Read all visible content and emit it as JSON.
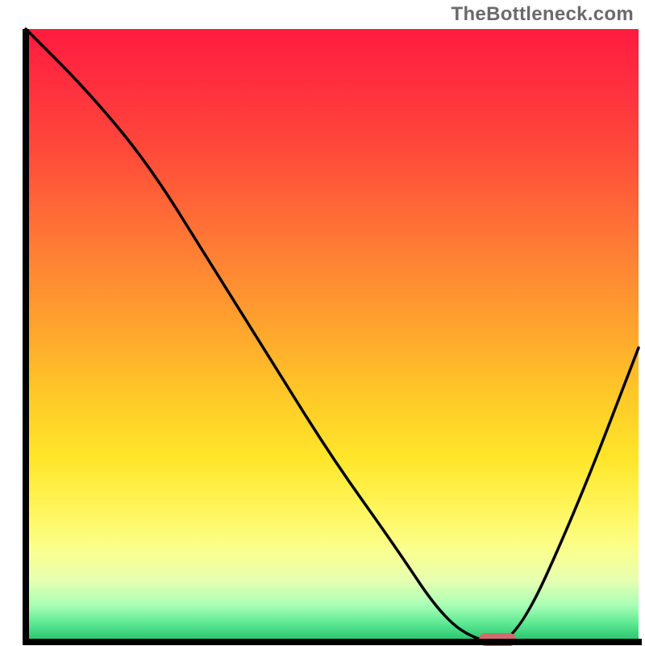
{
  "watermark": "TheBottleneck.com",
  "colors": {
    "gradient_top": "#ff1b3f",
    "gradient_mid": "#ffe62a",
    "gradient_bottom": "#22c06a",
    "curve": "#000000",
    "marker": "#d26b6b",
    "axes": "#000000"
  },
  "chart_data": {
    "type": "line",
    "title": "",
    "xlabel": "",
    "ylabel": "",
    "xlim": [
      0,
      100
    ],
    "ylim": [
      0,
      100
    ],
    "x": [
      0,
      10,
      20,
      30,
      40,
      50,
      60,
      68,
      74,
      80,
      90,
      100
    ],
    "values": [
      100,
      90,
      78,
      62,
      46,
      30,
      16,
      4,
      0,
      0,
      22,
      48
    ],
    "marker": {
      "x_range": [
        74,
        80
      ],
      "y": 0
    },
    "background_gradient": {
      "orientation": "vertical",
      "stops": [
        {
          "pos": 0.0,
          "color": "#ff1b3f"
        },
        {
          "pos": 0.35,
          "color": "#ff7a35"
        },
        {
          "pos": 0.7,
          "color": "#ffe62a"
        },
        {
          "pos": 0.9,
          "color": "#e6ffb1"
        },
        {
          "pos": 1.0,
          "color": "#22c06a"
        }
      ]
    },
    "legend": null,
    "grid": false
  }
}
